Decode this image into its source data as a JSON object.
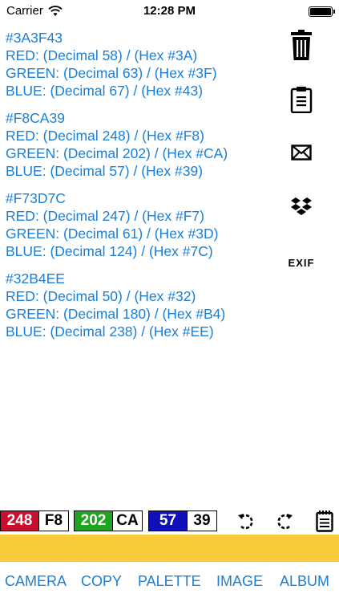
{
  "status_bar": {
    "carrier": "Carrier",
    "time": "12:28 PM"
  },
  "colors": [
    {
      "hex": "#3A3F43",
      "red": "RED: (Decimal 58) / (Hex #3A)",
      "green": "GREEN: (Decimal 63) / (Hex #3F)",
      "blue": "BLUE: (Decimal 67) / (Hex #43)"
    },
    {
      "hex": "#F8CA39",
      "red": "RED: (Decimal 248) / (Hex #F8)",
      "green": "GREEN: (Decimal 202) / (Hex #CA)",
      "blue": "BLUE: (Decimal 57) / (Hex #39)"
    },
    {
      "hex": "#F73D7C",
      "red": "RED: (Decimal 247) / (Hex #F7)",
      "green": "GREEN: (Decimal 61) / (Hex #3D)",
      "blue": "BLUE: (Decimal 124) / (Hex #7C)"
    },
    {
      "hex": "#32B4EE",
      "red": "RED: (Decimal 50) / (Hex #32)",
      "green": "GREEN: (Decimal 180) / (Hex #B4)",
      "blue": "BLUE: (Decimal 238) / (Hex #EE)"
    }
  ],
  "side_actions": {
    "icons": [
      "trash-icon",
      "clipboard-icon",
      "mail-icon",
      "dropbox-icon"
    ],
    "exif_label": "EXIF"
  },
  "swatch": {
    "red": {
      "dec": "248",
      "hex": "F8",
      "color": "#C8102E"
    },
    "green": {
      "dec": "202",
      "hex": "CA",
      "color": "#1FA51F"
    },
    "blue": {
      "dec": "57",
      "hex": "39",
      "color": "#1010B8"
    }
  },
  "tools": [
    "rotate-left-icon",
    "rotate-right-icon",
    "notepad-icon"
  ],
  "selected_color": "#F8CA39",
  "accent_color": "#1a7fd6",
  "bottom_nav": {
    "camera": "CAMERA",
    "copy": "COPY",
    "palette": "PALETTE",
    "image": "IMAGE",
    "album": "ALBUM"
  }
}
